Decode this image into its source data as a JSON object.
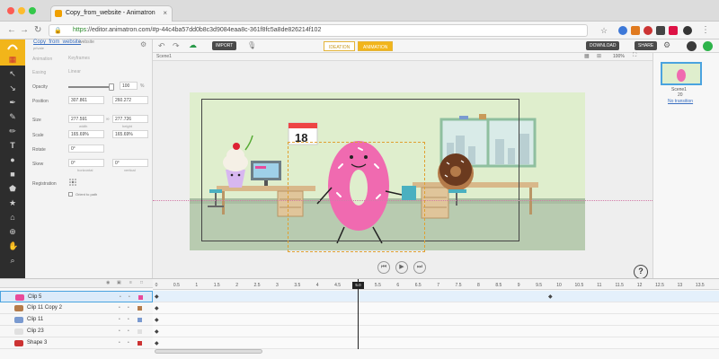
{
  "browser": {
    "tab_title": "Copy_from_website - Animatron",
    "url_scheme": "https",
    "url_rest": "://editor.animatron.com/#p-44c4ba57dd0b8c3d9084eaa8c-361f8fc5a8de826214f102"
  },
  "toolbar": {
    "import_label": "IMPORT",
    "ideation_label": "IDEATION",
    "animation_label": "ANIMATION",
    "download_label": "DOWNLOAD",
    "share_label": "SHARE"
  },
  "project": {
    "name": "Copy_from_website",
    "owner": "website",
    "sub": "private"
  },
  "props": {
    "animation_label": "Animation",
    "animation_value": "Keyframes",
    "easing_label": "Easing",
    "easing_value": "Linear",
    "opacity_label": "Opacity",
    "opacity_value": "100",
    "opacity_unit": "%",
    "opacity_fraction": 1.0,
    "position_label": "Position",
    "position_x": "307.861",
    "position_y": "260.272",
    "size_label": "Size",
    "size_w": "277.591",
    "size_h": "277.726",
    "size_sub_w": "width",
    "size_sub_h": "height",
    "scale_label": "Scale",
    "scale_w": "165.69%",
    "scale_h": "165.69%",
    "rotate_label": "Rotate",
    "rotate_value": "0°",
    "skew_label": "Skew",
    "skew_x": "0°",
    "skew_y": "0°",
    "skew_sub_x": "horizontal",
    "skew_sub_y": "vertical",
    "registration_label": "Registration",
    "orient_label": "Orient to path"
  },
  "scene": {
    "tab_label": "Scene1",
    "zoom": "100%",
    "calendar_number": "18"
  },
  "scenes_panel": {
    "scene_name": "Scene1",
    "scene_duration": "20",
    "no_transition": "No transition"
  },
  "timeline": {
    "current_time": "5.0",
    "ticks": [
      "0",
      "0.5",
      "1",
      "1.5",
      "2",
      "2.5",
      "3",
      "3.5",
      "4",
      "4.5",
      "5.0",
      "5.5",
      "6",
      "6.5",
      "7",
      "7.5",
      "8",
      "8.5",
      "9",
      "9.5",
      "10",
      "10.5",
      "11",
      "11.5",
      "12",
      "12.5",
      "13",
      "13.5"
    ],
    "layers": [
      {
        "name": "Clip 5",
        "color": "#e84a9a",
        "selected": true
      },
      {
        "name": "Clip 11 Copy 2",
        "color": "#b57b4a",
        "selected": false
      },
      {
        "name": "Clip 11",
        "color": "#7a9ad0",
        "selected": false
      },
      {
        "name": "Clip 23",
        "color": "#e0e0e0",
        "selected": false
      },
      {
        "name": "Shape 3",
        "color": "#cc3333",
        "selected": false
      }
    ]
  },
  "colors": {
    "accent": "#f2b51a",
    "dark_toolbar": "#2d2d2d",
    "scene_bg": "#dfeecd",
    "donut_pink": "#f06ab0",
    "selection": "#4aa3df"
  }
}
